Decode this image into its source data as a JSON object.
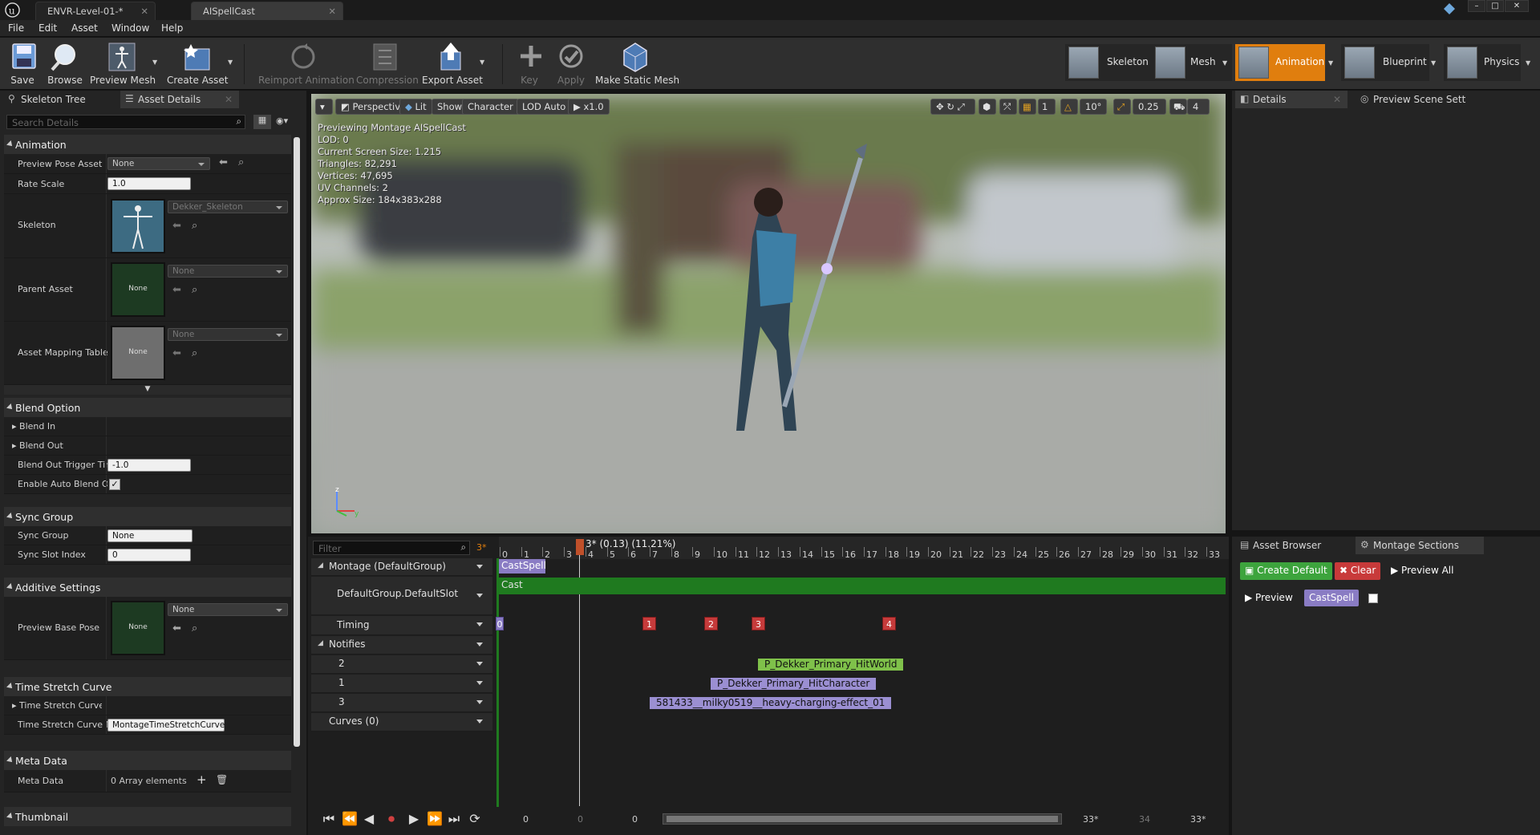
{
  "window": {
    "tabs": [
      {
        "label": "ENVR-Level-01-*"
      },
      {
        "label": "AISpellCast"
      }
    ]
  },
  "menu": [
    "File",
    "Edit",
    "Asset",
    "Window",
    "Help"
  ],
  "toolbar": {
    "buttons": [
      {
        "label": "Save",
        "icon": "save-icon",
        "enabled": true
      },
      {
        "label": "Browse",
        "icon": "browse-icon",
        "enabled": true
      },
      {
        "label": "Preview Mesh",
        "icon": "preview-mesh-icon",
        "enabled": true
      },
      {
        "label": "Create Asset",
        "icon": "create-asset-icon",
        "enabled": true
      },
      {
        "label": "Reimport Animation",
        "icon": "reimport-icon",
        "enabled": false
      },
      {
        "label": "Compression",
        "icon": "compression-icon",
        "enabled": false
      },
      {
        "label": "Export Asset",
        "icon": "export-icon",
        "enabled": true
      },
      {
        "label": "Key",
        "icon": "key-plus-icon",
        "enabled": false
      },
      {
        "label": "Apply",
        "icon": "apply-check-icon",
        "enabled": false
      },
      {
        "label": "Make Static Mesh",
        "icon": "static-mesh-icon",
        "enabled": true
      }
    ],
    "modes": [
      {
        "label": "Skeleton",
        "active": false
      },
      {
        "label": "Mesh",
        "active": false
      },
      {
        "label": "Animation",
        "active": true
      },
      {
        "label": "Blueprint",
        "active": false
      },
      {
        "label": "Physics",
        "active": false
      }
    ]
  },
  "left_panel": {
    "tabs": [
      "Skeleton Tree",
      "Asset Details"
    ],
    "search_placeholder": "Search Details",
    "sections": {
      "animation": {
        "title": "Animation",
        "preview_pose_label": "Preview Pose Asset",
        "preview_pose_value": "None",
        "rate_scale_label": "Rate Scale",
        "rate_scale_value": "1.0",
        "skeleton_label": "Skeleton",
        "skeleton_value": "Dekker_Skeleton",
        "parent_label": "Parent Asset",
        "parent_value": "None",
        "parent_thumb": "None",
        "mapping_label": "Asset Mapping Table",
        "mapping_value": "None",
        "mapping_thumb": "None"
      },
      "blend": {
        "title": "Blend Option",
        "blend_in": "Blend In",
        "blend_out": "Blend Out",
        "trigger_label": "Blend Out Trigger Tim",
        "trigger_value": "-1.0",
        "auto_label": "Enable Auto Blend Ou",
        "auto_checked": true
      },
      "sync": {
        "title": "Sync Group",
        "group_label": "Sync Group",
        "group_value": "None",
        "slot_label": "Sync Slot Index",
        "slot_value": "0"
      },
      "additive": {
        "title": "Additive Settings",
        "base_label": "Preview Base Pose",
        "base_value": "None",
        "base_thumb": "None"
      },
      "timestretch": {
        "title": "Time Stretch Curve",
        "curve_label": "Time Stretch Curve",
        "curve_name_label": "Time Stretch Curve N",
        "curve_name_value": "MontageTimeStretchCurve"
      },
      "meta": {
        "title": "Meta Data",
        "label": "Meta Data",
        "value": "0 Array elements"
      },
      "thumbnail": {
        "title": "Thumbnail"
      }
    }
  },
  "viewport": {
    "buttons": [
      "Perspective",
      "Lit",
      "Show",
      "Character",
      "LOD Auto",
      "x1.0"
    ],
    "right_controls": [
      "10°",
      "0.25",
      "4",
      "1"
    ],
    "info": [
      "Previewing Montage AISpellCast",
      "LOD: 0",
      "Current Screen Size: 1.215",
      "Triangles: 82,291",
      "Vertices: 47,695",
      "UV Channels: 2",
      "Approx Size: 184x383x288"
    ]
  },
  "right_panel": {
    "tabs": [
      "Details",
      "Preview Scene Sett"
    ]
  },
  "timeline": {
    "filter_placeholder": "Filter",
    "filter_count": "3*",
    "playhead_label": "3* (0.13) (11.21%)",
    "ticks": [
      "0",
      "1",
      "2",
      "3",
      "4",
      "5",
      "6",
      "7",
      "8",
      "9",
      "10",
      "11",
      "12",
      "13",
      "14",
      "15",
      "16",
      "17",
      "18",
      "19",
      "20",
      "21",
      "22",
      "23",
      "24",
      "25",
      "26",
      "27",
      "28",
      "29",
      "30",
      "31",
      "32",
      "33"
    ],
    "tracks": {
      "montage": "Montage (DefaultGroup)",
      "slot": "DefaultGroup.DefaultSlot",
      "timing": "Timing",
      "notifies": "Notifies",
      "n2": "2",
      "n1": "1",
      "n3": "3",
      "curves": "Curves  (0)"
    },
    "section_label": "CastSpell",
    "slot_segment": "Cast",
    "timing_markers": [
      "0",
      "1",
      "2",
      "3",
      "4"
    ],
    "notifies": [
      "P_Dekker_Primary_HitWorld",
      "P_Dekker_Primary_HitCharacter",
      "581433__milky0519__heavy-charging-effect_01"
    ],
    "bottom": {
      "left_start": "0",
      "playhead": "0",
      "range_start": "0",
      "range_end": "33*",
      "frame": "34",
      "end": "33*"
    }
  },
  "sections_panel": {
    "tabs": [
      "Asset Browser",
      "Montage Sections"
    ],
    "create_default": "Create Default",
    "clear": "Clear",
    "preview_all": "Preview All",
    "preview": "Preview",
    "section": "CastSpell"
  },
  "colors": {
    "accent": "#e07e0e",
    "green_btn": "#3da43d",
    "red_btn": "#c83a3a",
    "section_purple": "#8a7cc4",
    "slot_green": "#1f7a1f",
    "notify_green": "#7fc14a",
    "notify_purple": "#9b8fd2"
  }
}
